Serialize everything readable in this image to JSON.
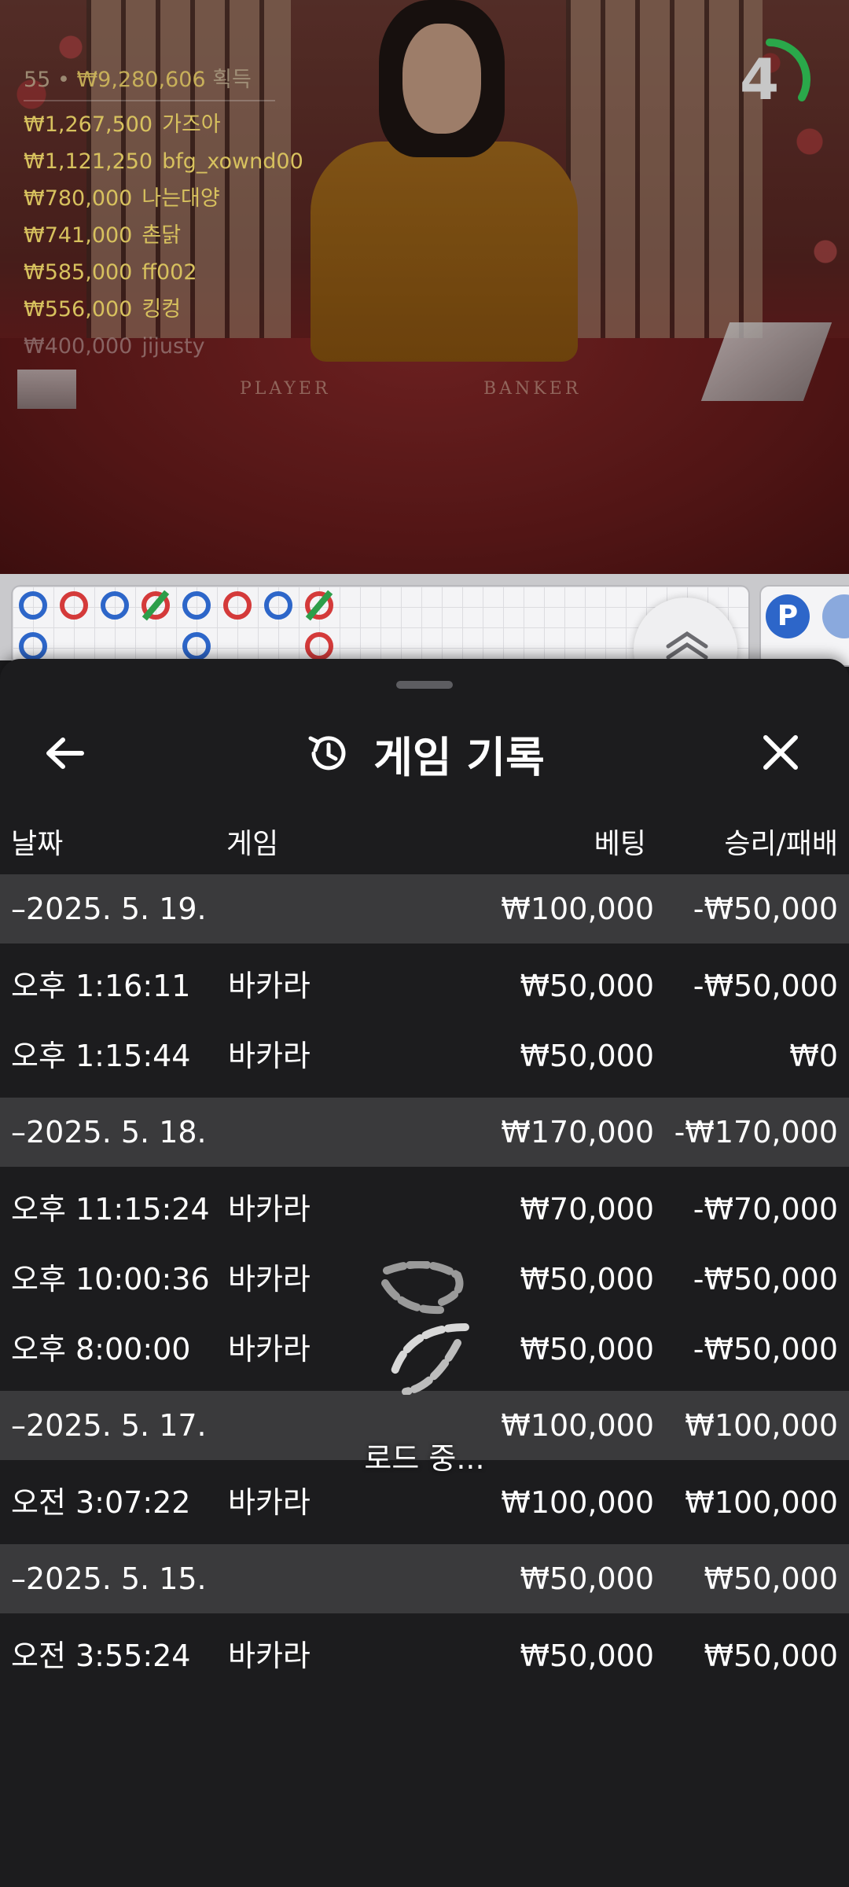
{
  "stream": {
    "leaderboard": {
      "header_count": "55",
      "header_amount": "₩9,280,606",
      "header_label": "획득",
      "entries": [
        {
          "amount": "₩1,267,500",
          "name": "가즈아"
        },
        {
          "amount": "₩1,121,250",
          "name": "bfg_xownd00"
        },
        {
          "amount": "₩780,000",
          "name": "나는대양"
        },
        {
          "amount": "₩741,000",
          "name": "촌닭"
        },
        {
          "amount": "₩585,000",
          "name": "ff002"
        },
        {
          "amount": "₩556,000",
          "name": "킹컹"
        },
        {
          "amount": "₩400,000",
          "name": "jijusty"
        }
      ]
    },
    "timer_value": "4",
    "table_labels": {
      "player": "PLAYER",
      "banker": "BANKER"
    },
    "side_chip_label": "P"
  },
  "sheet": {
    "title": "게임 기록",
    "columns": {
      "date": "날짜",
      "game": "게임",
      "bet": "베팅",
      "win_loss": "승리/패배"
    },
    "groups": [
      {
        "date": "–2025. 5. 19.",
        "bet": "₩100,000",
        "win_loss": "-₩50,000",
        "rows": [
          {
            "time": "오후 1:16:11",
            "game": "바카라",
            "bet": "₩50,000",
            "win_loss": "-₩50,000"
          },
          {
            "time": "오후 1:15:44",
            "game": "바카라",
            "bet": "₩50,000",
            "win_loss": "₩0"
          }
        ]
      },
      {
        "date": "–2025. 5. 18.",
        "bet": "₩170,000",
        "win_loss": "-₩170,000",
        "rows": [
          {
            "time": "오후 11:15:24",
            "game": "바카라",
            "bet": "₩70,000",
            "win_loss": "-₩70,000"
          },
          {
            "time": "오후 10:00:36",
            "game": "바카라",
            "bet": "₩50,000",
            "win_loss": "-₩50,000"
          },
          {
            "time": "오후 8:00:00",
            "game": "바카라",
            "bet": "₩50,000",
            "win_loss": "-₩50,000"
          }
        ]
      },
      {
        "date": "–2025. 5. 17.",
        "bet": "₩100,000",
        "win_loss": "₩100,000",
        "rows": [
          {
            "time": "오전 3:07:22",
            "game": "바카라",
            "bet": "₩100,000",
            "win_loss": "₩100,000"
          }
        ]
      },
      {
        "date": "–2025. 5. 15.",
        "bet": "₩50,000",
        "win_loss": "₩50,000",
        "rows": [
          {
            "time": "오전 3:55:24",
            "game": "바카라",
            "bet": "₩50,000",
            "win_loss": "₩50,000"
          }
        ]
      }
    ],
    "loading_text": "로드 중..."
  },
  "colors": {
    "sheet_bg": "#1c1c1e",
    "group_row_bg": "#3a3a3c",
    "leaderboard_gold": "#d7c15e",
    "timer_arc": "#2aa84a",
    "road_blue": "#2d66c9",
    "road_red": "#d43a3a"
  },
  "icons": {
    "back": "arrow-left-icon",
    "history": "history-clock-icon",
    "close": "close-x-icon",
    "expand": "chevron-up-double-icon",
    "loading": "loading-spinner-icon"
  }
}
